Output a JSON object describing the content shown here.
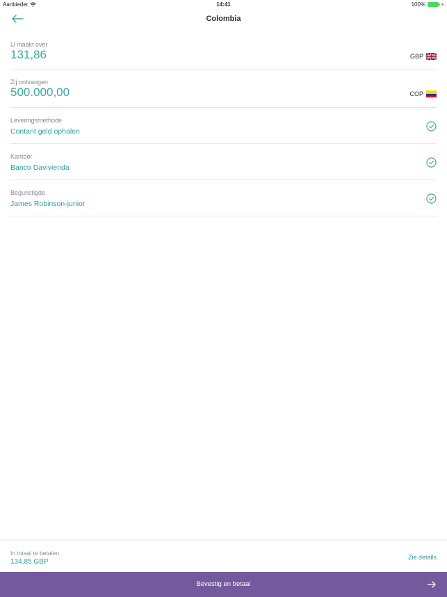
{
  "status_bar": {
    "carrier": "Aanbieder",
    "time": "14:41",
    "battery": "100%"
  },
  "header": {
    "title": "Colombia",
    "back_icon": "arrow-left-icon"
  },
  "send": {
    "label": "U maakt over",
    "amount": "131,86",
    "currency": "GBP",
    "flag": "uk-flag-icon"
  },
  "receive": {
    "label": "Zij ontvangen",
    "amount": "500.000,00",
    "currency": "COP",
    "flag": "colombia-flag-icon"
  },
  "options": [
    {
      "label": "Leveringsmethode",
      "value": "Contant geld ophalen",
      "icon": "check-circle-icon"
    },
    {
      "label": "Kantoor",
      "value": "Banco Davivienda",
      "icon": "check-circle-icon"
    },
    {
      "label": "Begunstigde",
      "value": "James Robinson-junior",
      "icon": "check-circle-icon"
    }
  ],
  "footer": {
    "total_label": "In totaal te betalen",
    "total_value": "134,85 GBP",
    "details_link": "Zie details"
  },
  "cta": {
    "label": "Bevestig en betaal",
    "icon": "arrow-right-icon"
  },
  "colors": {
    "accent": "#2e9e9a",
    "cta_background": "#745a9c",
    "battery": "#4cd964"
  }
}
